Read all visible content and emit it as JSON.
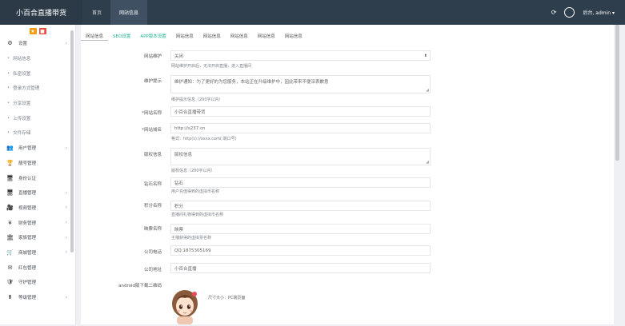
{
  "app": {
    "title": "小百合直播带货"
  },
  "topnav": [
    {
      "label": "首页",
      "active": false
    },
    {
      "label": "网站信息",
      "active": true
    }
  ],
  "topright": {
    "refresh_icon": "refresh-icon",
    "user_name": "后台, admin ▾"
  },
  "sidebar": {
    "badges": [
      {
        "text": "★",
        "color": "#f39c12"
      },
      {
        "text": "■",
        "color": "#e74c3c"
      }
    ],
    "items": [
      {
        "label": "设置",
        "icon": "gear-icon",
        "glyph": "⚙",
        "arrow": "›",
        "sub": false
      },
      {
        "label": "网站信息",
        "sub": true
      },
      {
        "label": "私密设置",
        "sub": true
      },
      {
        "label": "登录方式管理",
        "sub": true
      },
      {
        "label": "分享设置",
        "sub": true
      },
      {
        "label": "上传设置",
        "sub": true
      },
      {
        "label": "文件存储",
        "sub": true
      },
      {
        "label": "用户管理",
        "icon": "users-icon",
        "glyph": "👥",
        "arrow": "›",
        "sub": false
      },
      {
        "label": "靓号管理",
        "icon": "trophy-icon",
        "glyph": "🏆",
        "arrow": "",
        "sub": false
      },
      {
        "label": "身份认证",
        "icon": "monitor-icon",
        "glyph": "🖥",
        "arrow": "",
        "sub": false
      },
      {
        "label": "直播管理",
        "icon": "tv-icon",
        "glyph": "🖥",
        "arrow": "›",
        "sub": false
      },
      {
        "label": "视频管理",
        "icon": "video-icon",
        "glyph": "🎥",
        "arrow": "›",
        "sub": false
      },
      {
        "label": "财务管理",
        "icon": "yen-icon",
        "glyph": "¥",
        "arrow": "›",
        "sub": false
      },
      {
        "label": "家族管理",
        "icon": "bank-icon",
        "glyph": "🏛",
        "arrow": "›",
        "sub": false
      },
      {
        "label": "商城管理",
        "icon": "cart-icon",
        "glyph": "🛒",
        "arrow": "›",
        "sub": false
      },
      {
        "label": "红包管理",
        "icon": "envelope-icon",
        "glyph": "✉",
        "arrow": "",
        "sub": false
      },
      {
        "label": "守护管理",
        "icon": "shield-icon",
        "glyph": "🛡",
        "arrow": "",
        "sub": false
      },
      {
        "label": "等级管理",
        "icon": "level-icon",
        "glyph": "⬆",
        "arrow": "›",
        "sub": false
      }
    ]
  },
  "tabs": [
    {
      "label": "网站信息",
      "style": "first"
    },
    {
      "label": "SEO设置",
      "style": "teal"
    },
    {
      "label": "APP版本设置",
      "style": "teal"
    },
    {
      "label": "网站信息",
      "style": ""
    },
    {
      "label": "网站信息",
      "style": ""
    },
    {
      "label": "网站信息",
      "style": ""
    },
    {
      "label": "网站信息",
      "style": ""
    },
    {
      "label": "网站信息",
      "style": ""
    }
  ],
  "form": {
    "maintenance": {
      "label": "网站维护",
      "value": "关闭",
      "help": "网站维护开启后，无法开启直播，进入直播间"
    },
    "maintenance_notice": {
      "label": "维护提示",
      "value": "维护通知：为了更好的为您服务，本站正在升级维护中，因此带来不便深表歉意",
      "help": "维护提示信息（200字以内）"
    },
    "site_name": {
      "label": "*网站名称",
      "value": "小百合直播带货"
    },
    "site_domain": {
      "label": "*网站域名",
      "value": "http://s237.cn",
      "help": "格式：http(s)://xxxx.com(:端口号)"
    },
    "copyright": {
      "label": "版权信息",
      "value": "版权信息",
      "help": "版权信息（200字以内）"
    },
    "diamond_name": {
      "label": "钻石名称",
      "value": "钻石",
      "help": "用户充值得到的虚拟币名称"
    },
    "points_name": {
      "label": "积分名称",
      "value": "积分",
      "help": "直播间礼物得到的虚拟币名称"
    },
    "coin_name": {
      "label": "映票名称",
      "value": "映票",
      "help": "主播获得的虚拟票名称"
    },
    "phone": {
      "label": "公司电话",
      "value": "QQ:1875305169"
    },
    "address": {
      "label": "公司地址",
      "value": "小百合直播"
    },
    "qr": {
      "label": "android版下载二维码",
      "hint": "尺寸大小：PC端页面"
    }
  }
}
